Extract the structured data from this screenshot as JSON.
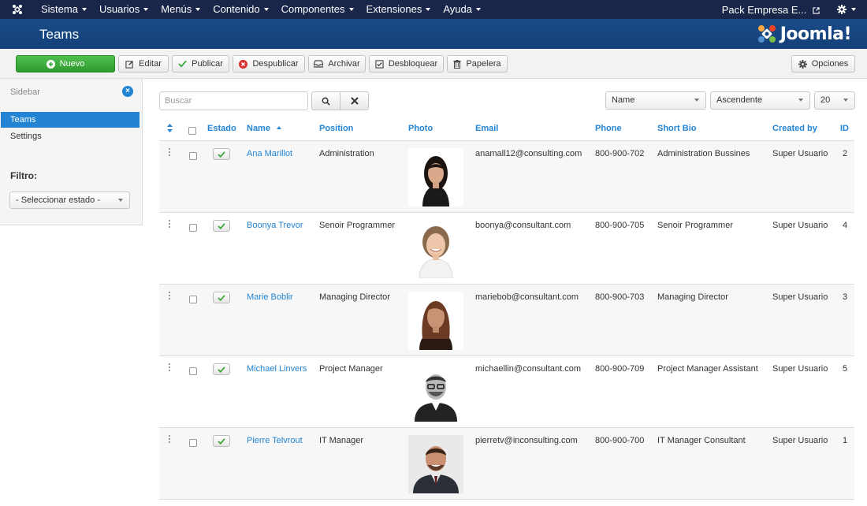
{
  "nav": {
    "items": [
      {
        "label": "Sistema"
      },
      {
        "label": "Usuarios"
      },
      {
        "label": "Menús"
      },
      {
        "label": "Contenido"
      },
      {
        "label": "Componentes"
      },
      {
        "label": "Extensiones"
      },
      {
        "label": "Ayuda"
      }
    ],
    "site_label": "Pack Empresa E...",
    "logo_icon": "joomla-icon",
    "external_icon": "external-link-icon",
    "settings_icon": "gear-icon"
  },
  "header": {
    "title": "Teams",
    "brand": "Joomla!"
  },
  "toolbar": {
    "new_label": "Nuevo",
    "edit_label": "Editar",
    "publish_label": "Publicar",
    "unpublish_label": "Despublicar",
    "archive_label": "Archivar",
    "unlock_label": "Desbloquear",
    "trash_label": "Papelera",
    "options_label": "Opciones"
  },
  "sidebar": {
    "heading": "Sidebar",
    "items": [
      {
        "label": "Teams",
        "active": true
      },
      {
        "label": "Settings",
        "active": false
      }
    ],
    "filter_label": "Filtro:",
    "filter_select": "- Seleccionar estado -"
  },
  "search": {
    "placeholder": "Buscar"
  },
  "list_controls": {
    "sort_field": "Name",
    "sort_direction": "Ascendente",
    "page_size": "20"
  },
  "table": {
    "headers": {
      "state": "Estado",
      "name": "Name",
      "position": "Position",
      "photo": "Photo",
      "email": "Email",
      "phone": "Phone",
      "bio": "Short Bio",
      "created_by": "Created by",
      "id": "ID"
    },
    "rows": [
      {
        "name": "Ana Marillot",
        "position": "Administration",
        "email": "anamall12@consulting.com",
        "phone": "800-900-702",
        "bio": "Administration Bussines",
        "created_by": "Super Usuario",
        "id": "2"
      },
      {
        "name": "Boonya Trevor",
        "position": "Senoir Programmer",
        "email": "boonya@consultant.com",
        "phone": "800-900-705",
        "bio": "Senoir Programmer",
        "created_by": "Super Usuario",
        "id": "4"
      },
      {
        "name": "Marie Boblir",
        "position": "Managing Director",
        "email": "mariebob@consultant.com",
        "phone": "800-900-703",
        "bio": "Managing Director",
        "created_by": "Super Usuario",
        "id": "3"
      },
      {
        "name": "Michael Linvers",
        "position": "Project Manager",
        "email": "michaellin@consultant.com",
        "phone": "800-900-709",
        "bio": "Project Manager Assistant",
        "created_by": "Super Usuario",
        "id": "5"
      },
      {
        "name": "Pierre Telvrout",
        "position": "IT Manager",
        "email": "pierretv@inconsulting.com",
        "phone": "800-900-700",
        "bio": "IT Manager Consultant",
        "created_by": "Super Usuario",
        "id": "1"
      }
    ]
  },
  "colors": {
    "navbar": "#19264a",
    "header": "#15407a",
    "accent": "#2384d3",
    "success": "#3aa83a"
  }
}
